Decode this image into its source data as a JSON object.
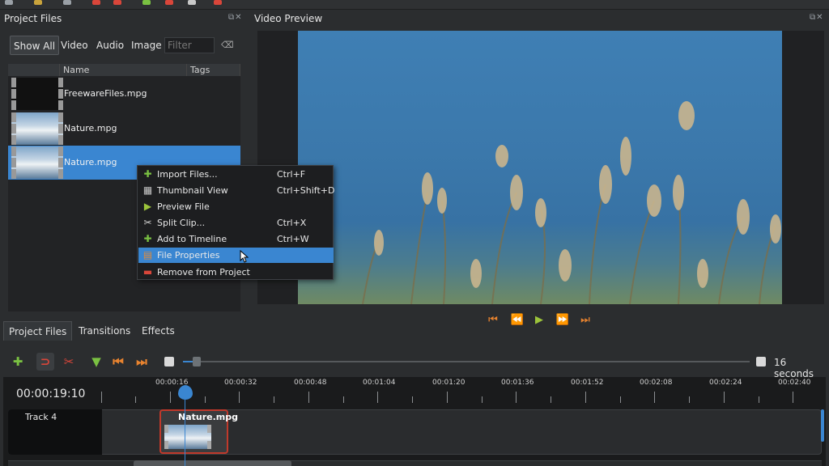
{
  "project_files": {
    "title": "Project Files",
    "dock_buttons": "⧉✕",
    "filters": [
      "Show All",
      "Video",
      "Audio",
      "Image"
    ],
    "filter_placeholder": "Filter",
    "columns": [
      "Name",
      "Tags"
    ],
    "files": [
      {
        "name": "FreewareFiles.mpg"
      },
      {
        "name": "Nature.mpg"
      },
      {
        "name": "Nature.mpg"
      }
    ]
  },
  "context_menu": {
    "items": [
      {
        "label": "Import Files...",
        "shortcut": "Ctrl+F",
        "icon": "plus-icon",
        "glyph": "✚",
        "color": "#7ac142"
      },
      {
        "label": "Thumbnail View",
        "shortcut": "Ctrl+Shift+D",
        "icon": "thumbnail-icon",
        "glyph": "▦",
        "color": "#c8c8c8"
      },
      {
        "label": "Preview File",
        "shortcut": "",
        "icon": "play-icon",
        "glyph": "▶",
        "color": "#9cc43b"
      },
      {
        "label": "Split Clip...",
        "shortcut": "Ctrl+X",
        "icon": "scissors-icon",
        "glyph": "✂",
        "color": "#d0d0d0"
      },
      {
        "label": "Add to Timeline",
        "shortcut": "Ctrl+W",
        "icon": "plus-icon",
        "glyph": "✚",
        "color": "#7ac142"
      },
      {
        "label": "File Properties",
        "shortcut": "",
        "icon": "properties-icon",
        "glyph": "▤",
        "color": "#e08b3a"
      },
      {
        "label": "Remove from Project",
        "shortcut": "",
        "icon": "remove-icon",
        "glyph": "▬",
        "color": "#d9463a"
      }
    ]
  },
  "bottom_tabs": [
    "Project Files",
    "Transitions",
    "Effects"
  ],
  "video_preview": {
    "title": "Video Preview",
    "dock_buttons": "⧉✕",
    "controls": [
      "jump-start-icon",
      "rewind-icon",
      "play-icon",
      "fast-forward-icon",
      "jump-end-icon"
    ],
    "control_glyphs": [
      "⏮",
      "⏪",
      "▶",
      "⏩",
      "⏭"
    ]
  },
  "timeline_toolbar": {
    "buttons": [
      {
        "icon": "add-track-icon",
        "glyph": "✚",
        "color": "#7ac142"
      },
      {
        "icon": "snap-icon",
        "glyph": "⊃",
        "color": "#d9463a"
      },
      {
        "icon": "razor-icon",
        "glyph": "✂",
        "color": "#d9463a"
      },
      {
        "icon": "add-marker-icon",
        "glyph": "▼",
        "color": "#7ac142"
      },
      {
        "icon": "previous-marker-icon",
        "glyph": "⏮",
        "color": "#e8832f"
      },
      {
        "icon": "next-marker-icon",
        "glyph": "⏭",
        "color": "#e8832f"
      }
    ],
    "zoom_label": "16 seconds"
  },
  "timeline": {
    "current_time": "00:00:19:10",
    "ruler_labels": [
      "00:00:16",
      "00:00:32",
      "00:00:48",
      "00:01:04",
      "00:01:20",
      "00:01:36",
      "00:01:52",
      "00:02:08",
      "00:02:24",
      "00:02:40"
    ],
    "track_name": "Track 4",
    "clip_name": "Nature.mpg"
  },
  "colors": {
    "accent": "#3a86d1",
    "clip_border": "#c0392b"
  }
}
